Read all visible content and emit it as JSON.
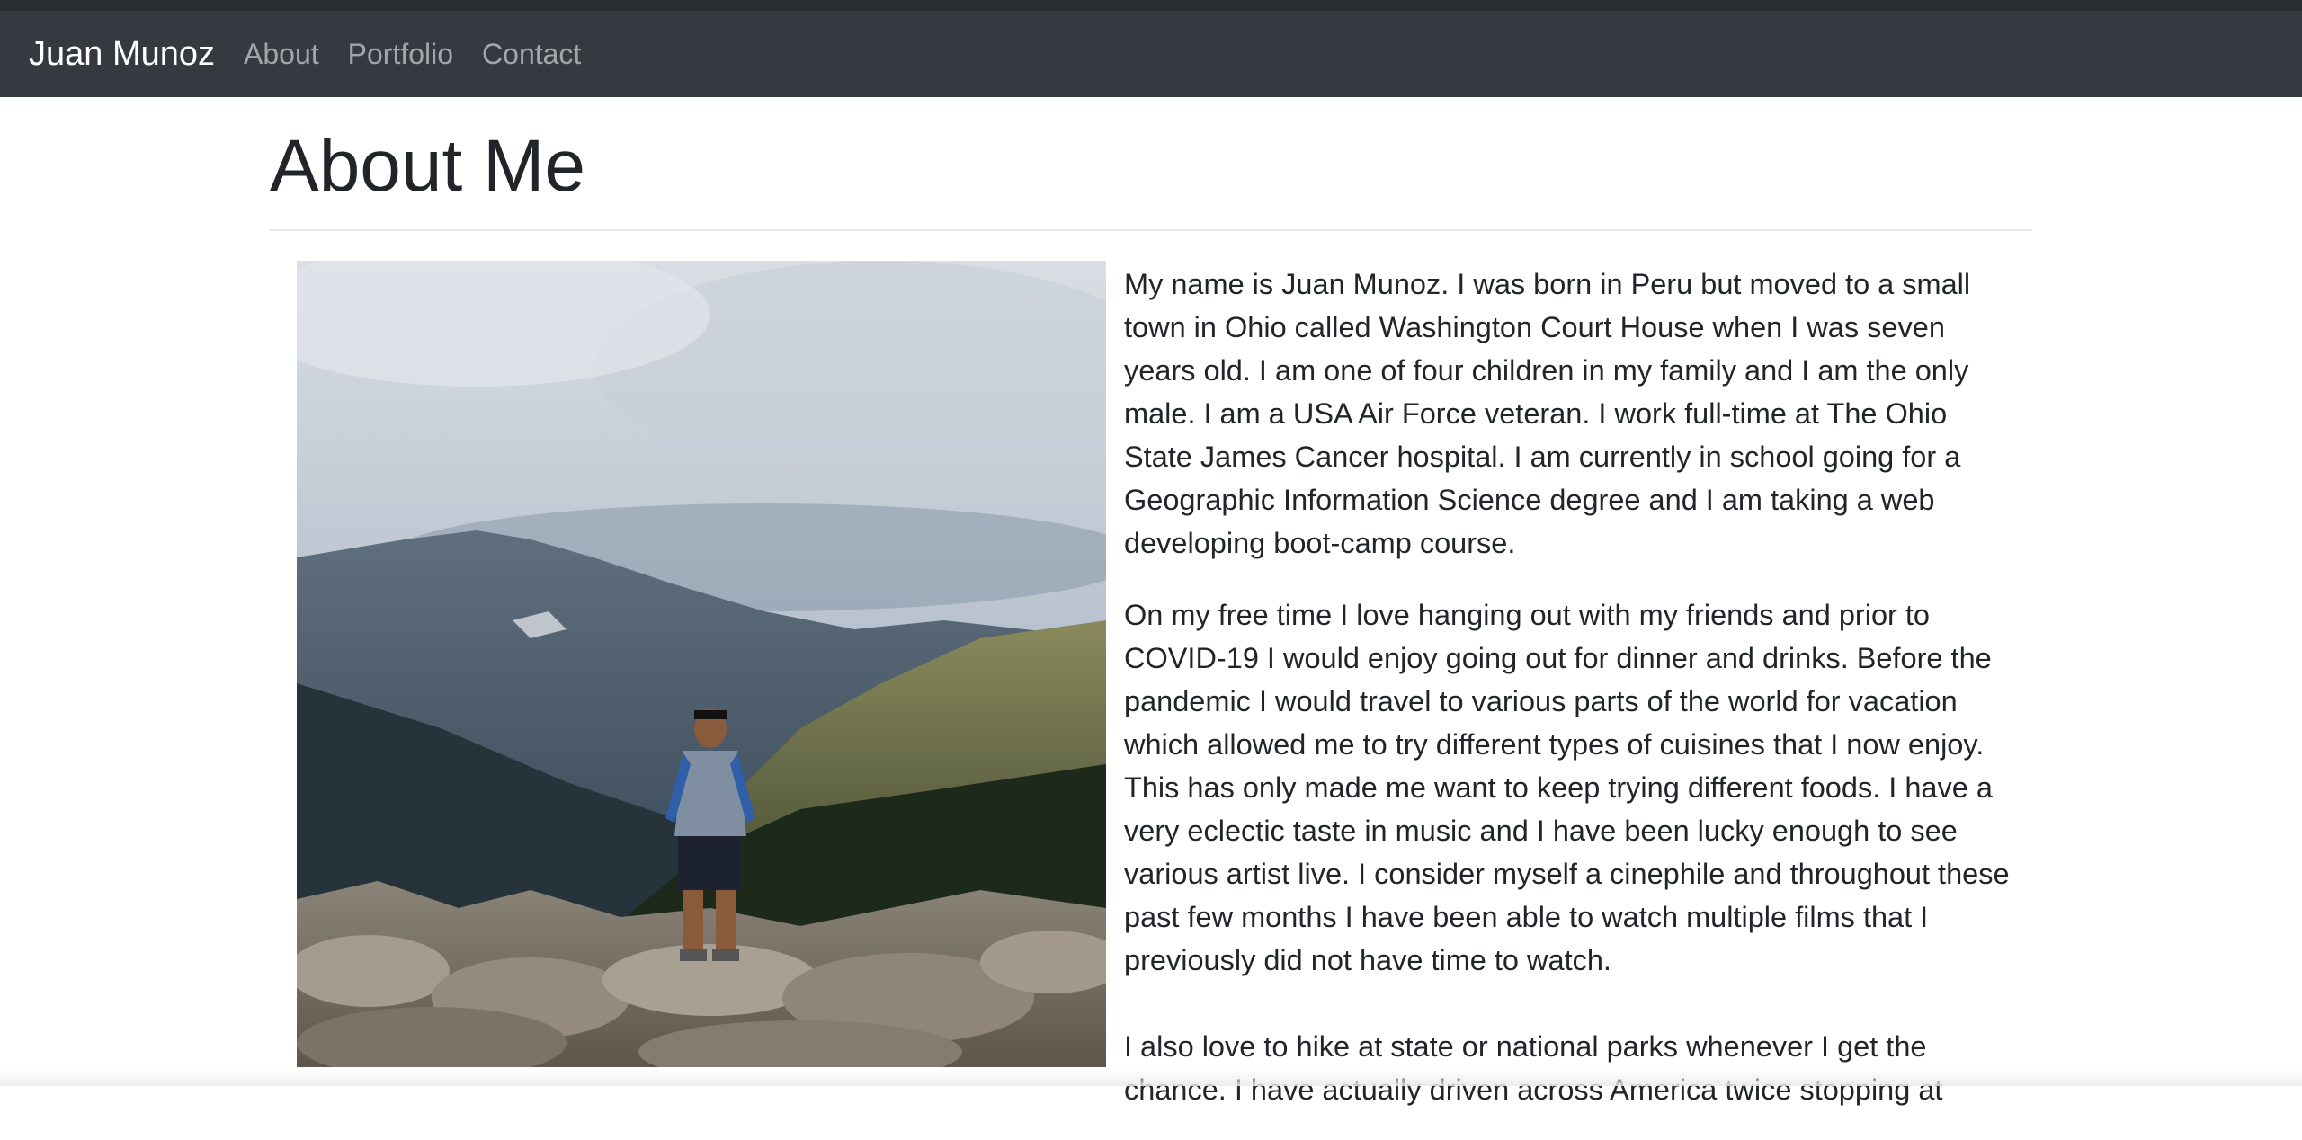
{
  "navbar": {
    "brand": "Juan Munoz",
    "links": [
      "About",
      "Portfolio",
      "Contact"
    ]
  },
  "main": {
    "title": "About Me",
    "paragraphs": [
      "My name is Juan Munoz. I was born in Peru but moved to a small town in Ohio called Washington Court House when I was seven years old. I am one of four children in my family and I am the only male. I am a USA Air Force veteran. I work full-time at The Ohio State James Cancer hospital. I am currently in school going for a Geographic Information Science degree and I am taking a web developing boot-camp course.",
      "On my free time I love hanging out with my friends and prior to COVID-19 I would enjoy going out for dinner and drinks. Before the pandemic I would travel to various parts of the world for vacation which allowed me to try different types of cuisines that I now enjoy. This has only made me want to keep trying different foods. I have a very eclectic taste in music and I have been lucky enough to see various artist live. I consider myself a cinephile and throughout these past few months I have been able to watch multiple films that I previously did not have time to watch.",
      "I also love to hike at state or national parks whenever I get the chance. I have actually driven across America twice stopping at"
    ]
  },
  "colors": {
    "navbar_bg": "#343a40",
    "text": "#212529",
    "nav_link": "rgba(255,255,255,0.55)"
  }
}
